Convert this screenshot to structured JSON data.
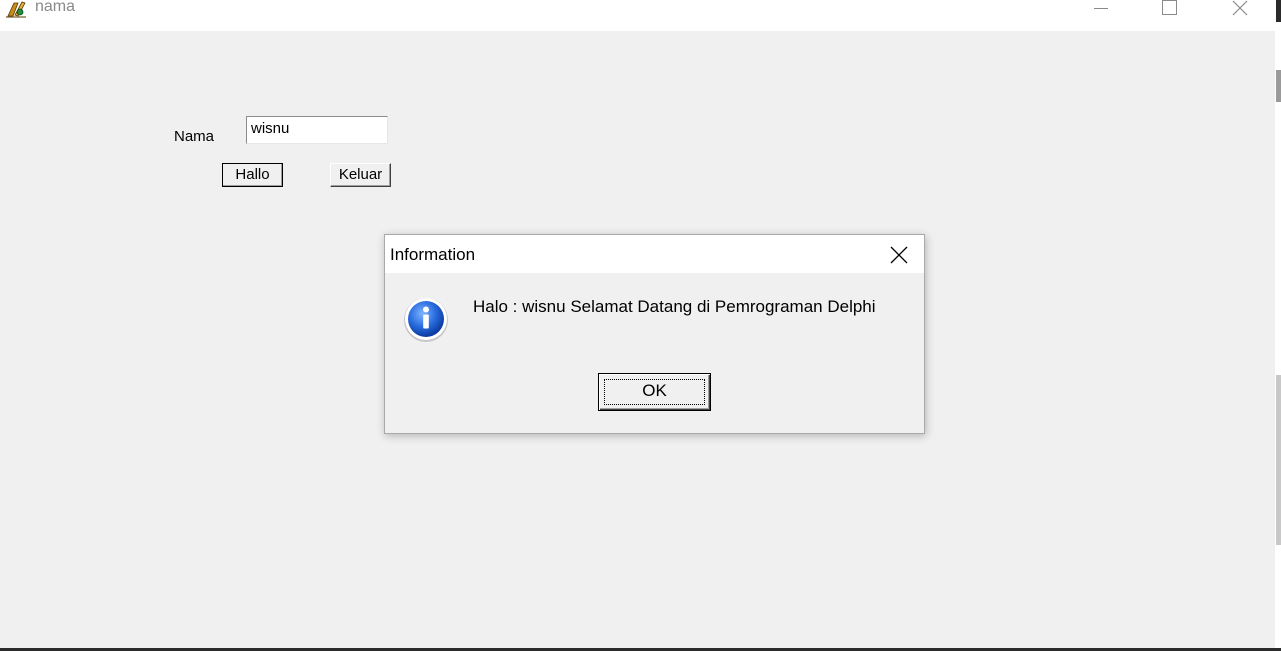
{
  "window": {
    "title": "nama",
    "controls": {
      "minimize_icon": "minimize-icon",
      "maximize_icon": "maximize-icon",
      "close_icon": "close-icon"
    }
  },
  "form": {
    "name_label": "Nama",
    "name_value": "wisnu",
    "hallo_button": "Hallo",
    "keluar_button": "Keluar"
  },
  "dialog": {
    "title": "Information",
    "icon": "information-icon",
    "message": "Halo : wisnu Selamat Datang di Pemrograman Delphi",
    "ok_button": "OK"
  },
  "colors": {
    "window_background": "#f0f0f0",
    "titlebar_background": "#ffffff",
    "info_icon_blue": "#1f5fcf"
  }
}
